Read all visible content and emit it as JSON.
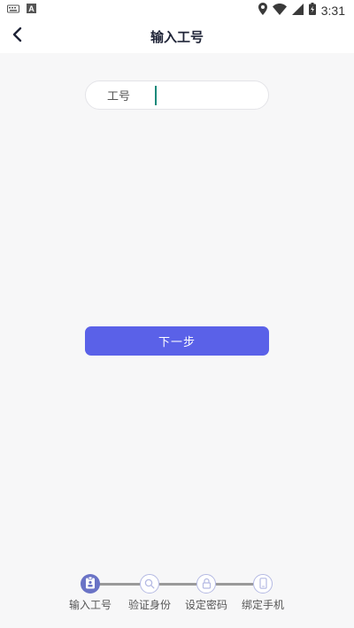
{
  "status_bar": {
    "time": "3:31",
    "icons": [
      "keyboard-icon",
      "font-icon",
      "location-icon",
      "wifi-icon",
      "signal-icon",
      "battery-icon"
    ]
  },
  "header": {
    "title": "输入工号",
    "back_icon": "chevron-left-icon"
  },
  "form": {
    "label": "工号",
    "value": "",
    "placeholder": ""
  },
  "next_button": {
    "label": "下一步"
  },
  "steps": [
    {
      "label": "输入工号",
      "state": "active",
      "icon": "id-badge-icon"
    },
    {
      "label": "验证身份",
      "state": "inactive",
      "icon": "search-icon"
    },
    {
      "label": "设定密码",
      "state": "inactive",
      "icon": "lock-icon"
    },
    {
      "label": "绑定手机",
      "state": "inactive",
      "icon": "phone-icon"
    }
  ],
  "colors": {
    "accent": "#5a61e8",
    "step_active": "#6a73c6",
    "cursor": "#15897a",
    "background": "#f7f7f8"
  }
}
